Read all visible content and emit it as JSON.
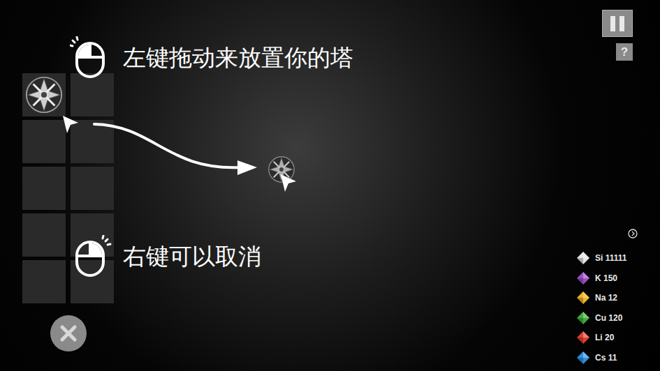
{
  "tower_slots": [
    {
      "has_tower": true
    },
    {
      "has_tower": false
    },
    {
      "has_tower": false
    },
    {
      "has_tower": false
    },
    {
      "has_tower": false
    },
    {
      "has_tower": false
    },
    {
      "has_tower": false
    },
    {
      "has_tower": false
    },
    {
      "has_tower": false
    },
    {
      "has_tower": false
    }
  ],
  "tutorial": [
    {
      "text": "左键拖动来放置你的塔",
      "mouse_button": "left"
    },
    {
      "text": "右键可以取消",
      "mouse_button": "right"
    }
  ],
  "top_buttons": {
    "help": "?"
  },
  "resources": [
    {
      "symbol": "Si",
      "amount": "11111",
      "color": "#e6e6e6"
    },
    {
      "symbol": "K",
      "amount": "150",
      "color": "#9b4fc9"
    },
    {
      "symbol": "Na",
      "amount": "12",
      "color": "#f0b323"
    },
    {
      "symbol": "Cu",
      "amount": "120",
      "color": "#3fae3a"
    },
    {
      "symbol": "Li",
      "amount": "20",
      "color": "#e0402f"
    },
    {
      "symbol": "Cs",
      "amount": "11",
      "color": "#2f8fe0"
    }
  ]
}
